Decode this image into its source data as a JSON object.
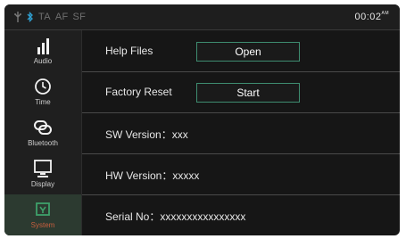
{
  "status_bar": {
    "flags": [
      "TA",
      "AF",
      "SF"
    ],
    "clock": "00:02",
    "clock_suffix": "AM",
    "icons": [
      "usb-icon",
      "bluetooth-icon"
    ]
  },
  "sidebar": {
    "items": [
      {
        "label": "Audio",
        "icon": "audio-bars-icon"
      },
      {
        "label": "Time",
        "icon": "clock-icon"
      },
      {
        "label": "Bluetooth",
        "icon": "bluetooth-link-icon"
      },
      {
        "label": "Display",
        "icon": "monitor-icon"
      },
      {
        "label": "System",
        "icon": "system-icon",
        "active": true
      }
    ]
  },
  "rows": [
    {
      "label": "Help Files",
      "button": "Open"
    },
    {
      "label": "Factory Reset",
      "button": "Start"
    },
    {
      "label": "SW Version：xxx"
    },
    {
      "label": "HW Version：xxxxx"
    },
    {
      "label": "Serial No：xxxxxxxxxxxxxxxx"
    }
  ],
  "colors": {
    "background": "#161616",
    "accent_border": "#3e8c70",
    "active_label": "#c95f3e",
    "active_bg": "#2c3a30"
  }
}
